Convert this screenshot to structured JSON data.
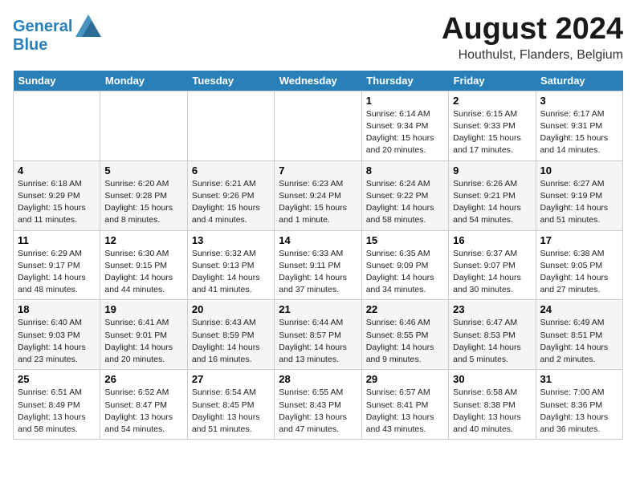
{
  "header": {
    "logo_line1": "General",
    "logo_line2": "Blue",
    "month_year": "August 2024",
    "location": "Houthulst, Flanders, Belgium"
  },
  "weekdays": [
    "Sunday",
    "Monday",
    "Tuesday",
    "Wednesday",
    "Thursday",
    "Friday",
    "Saturday"
  ],
  "weeks": [
    [
      {
        "day": "",
        "info": ""
      },
      {
        "day": "",
        "info": ""
      },
      {
        "day": "",
        "info": ""
      },
      {
        "day": "",
        "info": ""
      },
      {
        "day": "1",
        "info": "Sunrise: 6:14 AM\nSunset: 9:34 PM\nDaylight: 15 hours\nand 20 minutes."
      },
      {
        "day": "2",
        "info": "Sunrise: 6:15 AM\nSunset: 9:33 PM\nDaylight: 15 hours\nand 17 minutes."
      },
      {
        "day": "3",
        "info": "Sunrise: 6:17 AM\nSunset: 9:31 PM\nDaylight: 15 hours\nand 14 minutes."
      }
    ],
    [
      {
        "day": "4",
        "info": "Sunrise: 6:18 AM\nSunset: 9:29 PM\nDaylight: 15 hours\nand 11 minutes."
      },
      {
        "day": "5",
        "info": "Sunrise: 6:20 AM\nSunset: 9:28 PM\nDaylight: 15 hours\nand 8 minutes."
      },
      {
        "day": "6",
        "info": "Sunrise: 6:21 AM\nSunset: 9:26 PM\nDaylight: 15 hours\nand 4 minutes."
      },
      {
        "day": "7",
        "info": "Sunrise: 6:23 AM\nSunset: 9:24 PM\nDaylight: 15 hours\nand 1 minute."
      },
      {
        "day": "8",
        "info": "Sunrise: 6:24 AM\nSunset: 9:22 PM\nDaylight: 14 hours\nand 58 minutes."
      },
      {
        "day": "9",
        "info": "Sunrise: 6:26 AM\nSunset: 9:21 PM\nDaylight: 14 hours\nand 54 minutes."
      },
      {
        "day": "10",
        "info": "Sunrise: 6:27 AM\nSunset: 9:19 PM\nDaylight: 14 hours\nand 51 minutes."
      }
    ],
    [
      {
        "day": "11",
        "info": "Sunrise: 6:29 AM\nSunset: 9:17 PM\nDaylight: 14 hours\nand 48 minutes."
      },
      {
        "day": "12",
        "info": "Sunrise: 6:30 AM\nSunset: 9:15 PM\nDaylight: 14 hours\nand 44 minutes."
      },
      {
        "day": "13",
        "info": "Sunrise: 6:32 AM\nSunset: 9:13 PM\nDaylight: 14 hours\nand 41 minutes."
      },
      {
        "day": "14",
        "info": "Sunrise: 6:33 AM\nSunset: 9:11 PM\nDaylight: 14 hours\nand 37 minutes."
      },
      {
        "day": "15",
        "info": "Sunrise: 6:35 AM\nSunset: 9:09 PM\nDaylight: 14 hours\nand 34 minutes."
      },
      {
        "day": "16",
        "info": "Sunrise: 6:37 AM\nSunset: 9:07 PM\nDaylight: 14 hours\nand 30 minutes."
      },
      {
        "day": "17",
        "info": "Sunrise: 6:38 AM\nSunset: 9:05 PM\nDaylight: 14 hours\nand 27 minutes."
      }
    ],
    [
      {
        "day": "18",
        "info": "Sunrise: 6:40 AM\nSunset: 9:03 PM\nDaylight: 14 hours\nand 23 minutes."
      },
      {
        "day": "19",
        "info": "Sunrise: 6:41 AM\nSunset: 9:01 PM\nDaylight: 14 hours\nand 20 minutes."
      },
      {
        "day": "20",
        "info": "Sunrise: 6:43 AM\nSunset: 8:59 PM\nDaylight: 14 hours\nand 16 minutes."
      },
      {
        "day": "21",
        "info": "Sunrise: 6:44 AM\nSunset: 8:57 PM\nDaylight: 14 hours\nand 13 minutes."
      },
      {
        "day": "22",
        "info": "Sunrise: 6:46 AM\nSunset: 8:55 PM\nDaylight: 14 hours\nand 9 minutes."
      },
      {
        "day": "23",
        "info": "Sunrise: 6:47 AM\nSunset: 8:53 PM\nDaylight: 14 hours\nand 5 minutes."
      },
      {
        "day": "24",
        "info": "Sunrise: 6:49 AM\nSunset: 8:51 PM\nDaylight: 14 hours\nand 2 minutes."
      }
    ],
    [
      {
        "day": "25",
        "info": "Sunrise: 6:51 AM\nSunset: 8:49 PM\nDaylight: 13 hours\nand 58 minutes."
      },
      {
        "day": "26",
        "info": "Sunrise: 6:52 AM\nSunset: 8:47 PM\nDaylight: 13 hours\nand 54 minutes."
      },
      {
        "day": "27",
        "info": "Sunrise: 6:54 AM\nSunset: 8:45 PM\nDaylight: 13 hours\nand 51 minutes."
      },
      {
        "day": "28",
        "info": "Sunrise: 6:55 AM\nSunset: 8:43 PM\nDaylight: 13 hours\nand 47 minutes."
      },
      {
        "day": "29",
        "info": "Sunrise: 6:57 AM\nSunset: 8:41 PM\nDaylight: 13 hours\nand 43 minutes."
      },
      {
        "day": "30",
        "info": "Sunrise: 6:58 AM\nSunset: 8:38 PM\nDaylight: 13 hours\nand 40 minutes."
      },
      {
        "day": "31",
        "info": "Sunrise: 7:00 AM\nSunset: 8:36 PM\nDaylight: 13 hours\nand 36 minutes."
      }
    ]
  ]
}
